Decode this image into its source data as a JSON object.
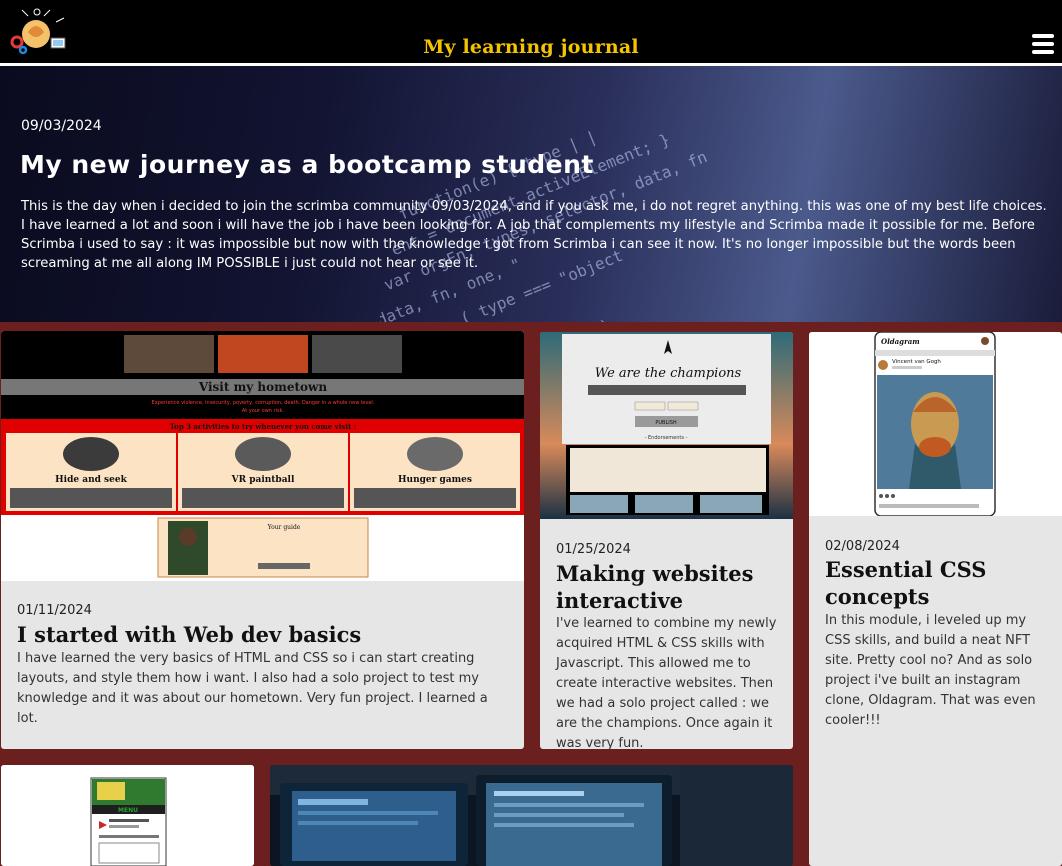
{
  "header": {
    "title": "My learning journal",
    "logo_icon": "brain-gears-logo-icon",
    "menu_icon": "hamburger-menu-icon",
    "title_color": "#f5c400"
  },
  "hero": {
    "date": "09/03/2024",
    "title": "My new journey as a bootcamp student",
    "text": "This is the day when i decided to join the scrimba community 09/03/2024, and if you ask me, i do not regret anything. this was one of my best life choices. I have learned a lot and soon i will have the job i have been looking for. A job that complements my lifestyle and Scrimba made it possible for me. Before Scrimba i used to say : it was impossible but now with the knowledge i got from Scrimba i can see it now. It's no longer impossible but the words been screaming at me all along IM POSSIBLE i just could not hear or see it."
  },
  "posts": [
    {
      "date": "01/11/2024",
      "title": "I started with Web dev basics",
      "text": "I have learned the very basics of HTML and CSS so i can start creating layouts, and style them how i want. I also had a solo project to test my knowledge and it was about our hometown. Very fun project. I learned a lot.",
      "thumb": {
        "banner": "Visit my hometown",
        "subtitle": "Experience violence, insecurity, poverty, corruption, death. Danger in a whole new level.",
        "subtitle2": "At your own risk.",
        "section_title": "Top 3 activities to try whenever you come visit :",
        "activities": [
          "Hide and seek",
          "VR paintball",
          "Hunger games"
        ],
        "guide_title": "Your guide"
      }
    },
    {
      "date": "01/25/2024",
      "title": "Making websites interactive",
      "text": "I've learned to combine my newly acquired HTML & CSS skills with Javascript. This allowed me to create interactive websites. Then we had a solo project called : we are the champions. Once again it was very fun.",
      "thumb": {
        "heading": "We are the champions",
        "button": "PUBLISH",
        "label": "- Endorsements -"
      }
    },
    {
      "date": "02/08/2024",
      "title": "Essential CSS concepts",
      "text": "In this module, i leveled up my CSS skills, and build a neat NFT site. Pretty cool no? And as solo project i've built an instagram clone, Oldagram. That was even cooler!!!",
      "thumb": {
        "app": "Oldagram",
        "user": "Vincent van Gogh"
      }
    }
  ],
  "bottom_thumbs": {
    "menu_label": "MENU"
  }
}
